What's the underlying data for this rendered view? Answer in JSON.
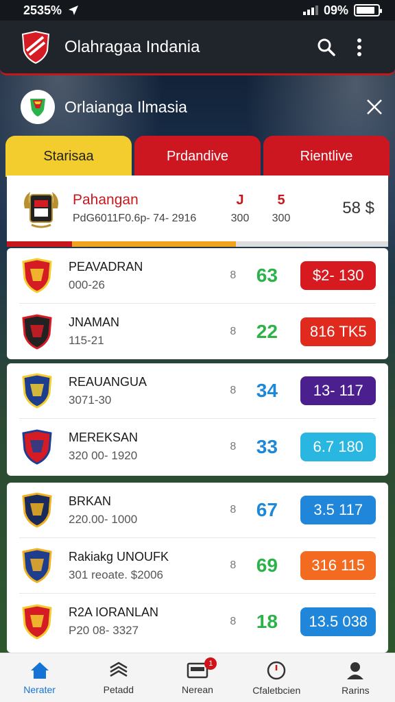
{
  "status": {
    "left_text": "2535%",
    "right_text": "09%",
    "battery_level": 0.85
  },
  "appbar": {
    "title": "Olahragaa Indania"
  },
  "banner": {
    "text": "Orlaianga Ilmasia"
  },
  "tabs": [
    {
      "label": "Starisaa"
    },
    {
      "label": "Prdandive"
    },
    {
      "label": "Rientlive"
    }
  ],
  "featured": {
    "name": "Pahangan",
    "subtitle": "PdG6011F0.6p- 74- 2916",
    "col1_top": "J",
    "col1_bottom": "300",
    "col2_top": "5",
    "col2_bottom": "300",
    "amount": "58 $",
    "progress_red": 0.17,
    "progress_orange": 0.43
  },
  "groups": [
    [
      {
        "name": "PEAVADRAN",
        "detail": "000-26",
        "fav_icon": "8",
        "score": "63",
        "score_color": "#2bb34a",
        "odds": "$2- 130",
        "odds_color": "#d71920"
      },
      {
        "name": "JNAMAN",
        "detail": "115-21",
        "fav_icon": "8",
        "score": "22",
        "score_color": "#2bb34a",
        "odds": "816 TK5",
        "odds_color": "#e02a1e"
      }
    ],
    [
      {
        "name": "REAUANGUA",
        "detail": "3071-30",
        "fav_icon": "8",
        "score": "34",
        "score_color": "#1e88d8",
        "odds": "13- 117",
        "odds_color": "#4b1f8e"
      },
      {
        "name": "MEREKSAN",
        "detail": "320 00- 1920",
        "fav_icon": "8",
        "score": "33",
        "score_color": "#1e88d8",
        "odds": "6.7 180",
        "odds_color": "#29b6e0"
      }
    ],
    [
      {
        "name": "BRKAN",
        "detail": "220.00- 1000",
        "fav_icon": "8",
        "score": "67",
        "score_color": "#1e88d8",
        "odds": "3.5 117",
        "odds_color": "#1f86d9"
      },
      {
        "name": "Rakiakg UNOUFK",
        "detail": "301 reoate. $2006",
        "fav_icon": "8",
        "score": "69",
        "score_color": "#2bb34a",
        "odds": "316 115",
        "odds_color": "#f26b21"
      },
      {
        "name": "R2A IORANLAN",
        "detail": "P20 08- 3327",
        "fav_icon": "8",
        "score": "18",
        "score_color": "#2bb34a",
        "odds": "13.5 038",
        "odds_color": "#1f86d9"
      }
    ]
  ],
  "bottom_nav": [
    {
      "label": "Nerater",
      "icon": "home-icon",
      "active": true
    },
    {
      "label": "Petadd",
      "icon": "layers-icon",
      "active": false
    },
    {
      "label": "Nerean",
      "icon": "news-icon",
      "active": false,
      "badge": "1"
    },
    {
      "label": "Cfaletbcien",
      "icon": "clock-icon",
      "active": false
    },
    {
      "label": "Rarins",
      "icon": "profile-icon",
      "active": false
    }
  ]
}
